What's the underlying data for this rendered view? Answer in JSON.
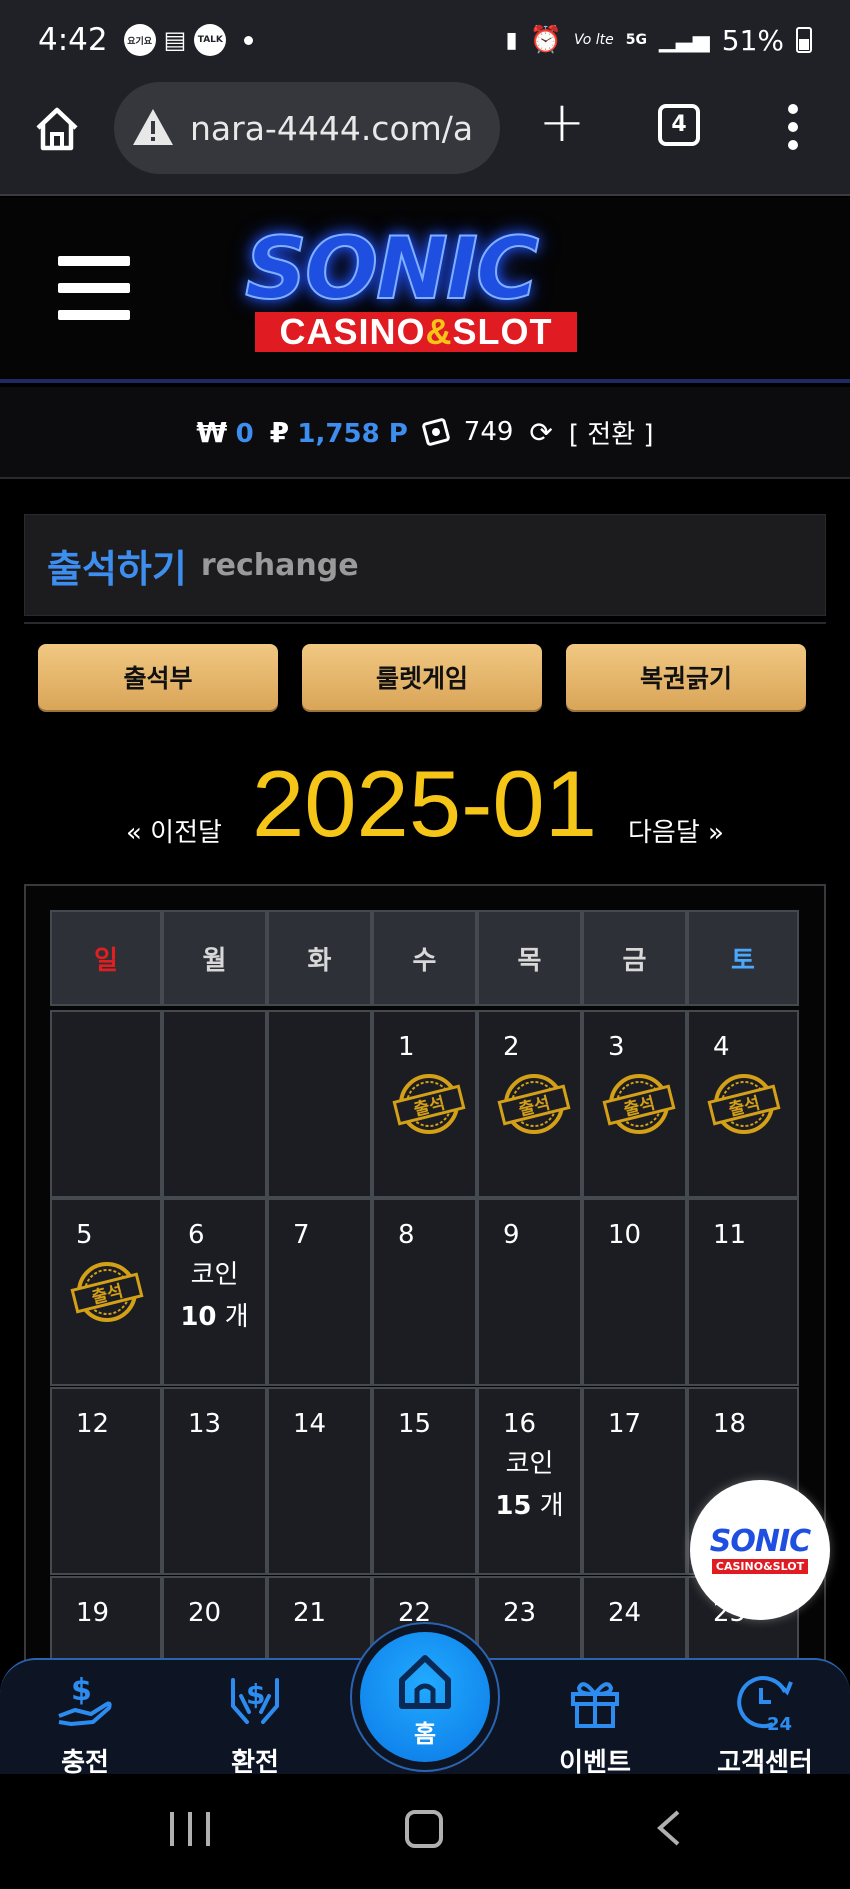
{
  "status_bar": {
    "time": "4:42",
    "icons": [
      "kakaotalk-badge-icon",
      "calendar-icon",
      "talk-icon",
      "notification-dot"
    ],
    "right_icons": [
      "battery-saver-icon",
      "alarm-icon",
      "volte-icon",
      "5g-icon",
      "signal-icon",
      "battery-icon"
    ],
    "volte_text": "Vo lte",
    "network": "5G",
    "battery": "51%"
  },
  "browser": {
    "url": "nara-4444.com/a",
    "tabs_count": "4"
  },
  "header": {
    "logo_main": "SONIC",
    "logo_sub_left": "CASINO",
    "logo_sub_amp": "&",
    "logo_sub_right": "SLOT"
  },
  "balance": {
    "won_symbol": "₩",
    "won_value": "0",
    "point_symbol": "₽",
    "point_value": "1,758 P",
    "chips_value": "749",
    "switch_label": "[ 전환 ]"
  },
  "section": {
    "title_ko": "출석하기",
    "title_en": "rechange"
  },
  "buttons": [
    "출석부",
    "룰렛게임",
    "복권긁기"
  ],
  "month_nav": {
    "prev": "« 이전달",
    "current": "2025-01",
    "next": "다음달 »"
  },
  "calendar": {
    "weekdays": [
      "일",
      "월",
      "화",
      "수",
      "목",
      "금",
      "토"
    ],
    "weekday_colors": [
      "#e02020",
      "#d8d8d8",
      "#d8d8d8",
      "#d8d8d8",
      "#d8d8d8",
      "#d8d8d8",
      "#4aa8ff"
    ],
    "stamp_text": "출석",
    "coin_label": "코인",
    "coin_unit": "개",
    "rows": [
      [
        {
          "day": "",
          "stamp": false
        },
        {
          "day": "",
          "stamp": false
        },
        {
          "day": "",
          "stamp": false
        },
        {
          "day": "1",
          "stamp": true
        },
        {
          "day": "2",
          "stamp": true
        },
        {
          "day": "3",
          "stamp": true
        },
        {
          "day": "4",
          "stamp": true
        }
      ],
      [
        {
          "day": "5",
          "stamp": true
        },
        {
          "day": "6",
          "stamp": false,
          "coin": "10"
        },
        {
          "day": "7",
          "stamp": false
        },
        {
          "day": "8",
          "stamp": false
        },
        {
          "day": "9",
          "stamp": false
        },
        {
          "day": "10",
          "stamp": false
        },
        {
          "day": "11",
          "stamp": false
        }
      ],
      [
        {
          "day": "12",
          "stamp": false
        },
        {
          "day": "13",
          "stamp": false
        },
        {
          "day": "14",
          "stamp": false
        },
        {
          "day": "15",
          "stamp": false
        },
        {
          "day": "16",
          "stamp": false,
          "coin": "15"
        },
        {
          "day": "17",
          "stamp": false
        },
        {
          "day": "18",
          "stamp": false
        }
      ],
      [
        {
          "day": "19",
          "stamp": false
        },
        {
          "day": "20",
          "stamp": false
        },
        {
          "day": "21",
          "stamp": false
        },
        {
          "day": "22",
          "stamp": false
        },
        {
          "day": "23",
          "stamp": false
        },
        {
          "day": "24",
          "stamp": false
        },
        {
          "day": "25",
          "stamp": false
        }
      ]
    ]
  },
  "floating_logo": {
    "main": "SONIC",
    "sub": "CASINO&SLOT"
  },
  "bottom_nav": {
    "items": [
      {
        "label": "충전",
        "icon": "deposit-hand-dollar-icon"
      },
      {
        "label": "환전",
        "icon": "exchange-hands-dollar-icon"
      },
      {
        "label": "홈",
        "icon": "home-icon"
      },
      {
        "label": "이벤트",
        "icon": "gift-icon"
      },
      {
        "label": "고객센터",
        "icon": "support-24h-icon"
      }
    ]
  },
  "colors": {
    "accent_blue": "#3e8ef0",
    "gold": "#f5c518",
    "button_gold": "#e2b46c",
    "logo_red": "#e01b22"
  }
}
